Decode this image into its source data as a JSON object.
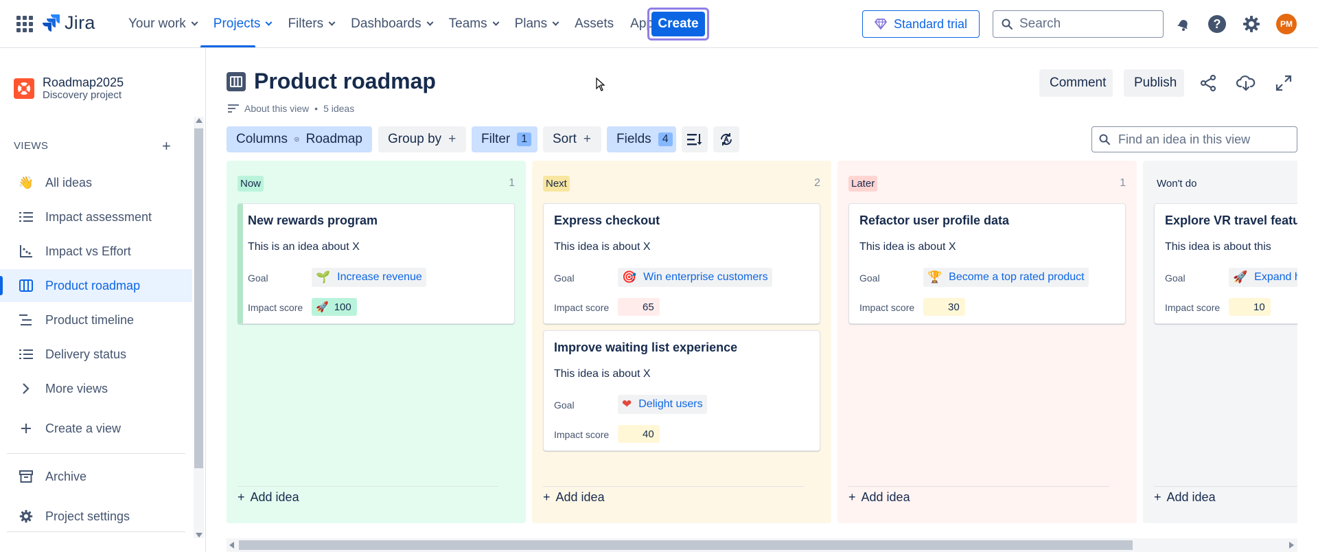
{
  "topnav": {
    "logo_text": "Jira",
    "items": [
      {
        "label": "Your work"
      },
      {
        "label": "Projects"
      },
      {
        "label": "Filters"
      },
      {
        "label": "Dashboards"
      },
      {
        "label": "Teams"
      },
      {
        "label": "Plans"
      },
      {
        "label": "Assets"
      },
      {
        "label": "Apps"
      }
    ],
    "create_label": "Create",
    "trial_label": "Standard trial",
    "search_placeholder": "Search",
    "avatar_initials": "PM",
    "accent_color": "#0c66e4"
  },
  "sidebar": {
    "project_name": "Roadmap2025",
    "project_type": "Discovery project",
    "views_heading": "VIEWS",
    "items": [
      {
        "label": "All ideas",
        "icon": "hand-wave-icon"
      },
      {
        "label": "Impact assessment",
        "icon": "list-icon"
      },
      {
        "label": "Impact vs Effort",
        "icon": "scatter-chart-icon"
      },
      {
        "label": "Product roadmap",
        "icon": "board-icon",
        "active": true
      },
      {
        "label": "Product timeline",
        "icon": "timeline-icon"
      },
      {
        "label": "Delivery status",
        "icon": "list-icon"
      },
      {
        "label": "More views",
        "icon": "chevron-right-icon"
      },
      {
        "label": "Create a view",
        "icon": "plus-icon"
      }
    ],
    "archive_label": "Archive",
    "settings_label": "Project settings"
  },
  "header": {
    "title": "Product roadmap",
    "about": "About this view",
    "ideas_count": "5 ideas",
    "comment_label": "Comment",
    "publish_label": "Publish"
  },
  "toolbar": {
    "columns_label": "Columns",
    "columns_value": "Roadmap",
    "groupby_label": "Group by",
    "filter_label": "Filter",
    "filter_count": "1",
    "sort_label": "Sort",
    "fields_label": "Fields",
    "fields_count": "4",
    "find_placeholder": "Find an idea in this view"
  },
  "columns": [
    {
      "name": "Now",
      "count": "1",
      "bg": "#e3fcef",
      "lozenge": "#baf3db",
      "cards": [
        {
          "title": "New rewards program",
          "desc": "This is an idea about X",
          "goal": "Increase revenue",
          "goal_icon": "seedling-icon",
          "goal_emoji": "🌱",
          "score": "100",
          "score_icon": "rocket-icon",
          "score_emoji": "🚀",
          "score_bg": "#baf3db",
          "selected": true
        }
      ],
      "add_label": "Add idea"
    },
    {
      "name": "Next",
      "count": "2",
      "bg": "#fff7e6",
      "lozenge": "#f8e6a0",
      "cards": [
        {
          "title": "Express checkout",
          "desc": "This idea is about X",
          "goal": "Win enterprise customers",
          "goal_icon": "target-icon",
          "goal_emoji": "🎯",
          "score": "65",
          "score_bg": "#ffeceb"
        },
        {
          "title": "Improve waiting list experience",
          "desc": "This idea is about X",
          "goal": "Delight users",
          "goal_icon": "heart-icon",
          "goal_emoji": "❤",
          "score": "40",
          "score_bg": "#fff7d6"
        }
      ],
      "add_label": "Add idea"
    },
    {
      "name": "Later",
      "count": "1",
      "bg": "#fff4f2",
      "lozenge": "#ffd5d2",
      "cards": [
        {
          "title": "Refactor user profile data",
          "desc": "This idea is about X",
          "goal": "Become a top rated product",
          "goal_icon": "trophy-icon",
          "goal_emoji": "🏆",
          "score": "30",
          "score_bg": "#fff7d6"
        }
      ],
      "add_label": "Add idea"
    },
    {
      "name": "Won't do",
      "count": "",
      "bg": "#f4f5f7",
      "lozenge": "#f4f5f7",
      "cards": [
        {
          "title": "Explore VR travel feature",
          "desc": "This idea is about this",
          "goal": "Expand ho",
          "goal_icon": "rocket-icon",
          "goal_emoji": "🚀",
          "score": "10",
          "score_bg": "#fff7d6"
        }
      ],
      "add_label": "Add idea"
    }
  ],
  "labels": {
    "goal": "Goal",
    "impact": "Impact score"
  }
}
